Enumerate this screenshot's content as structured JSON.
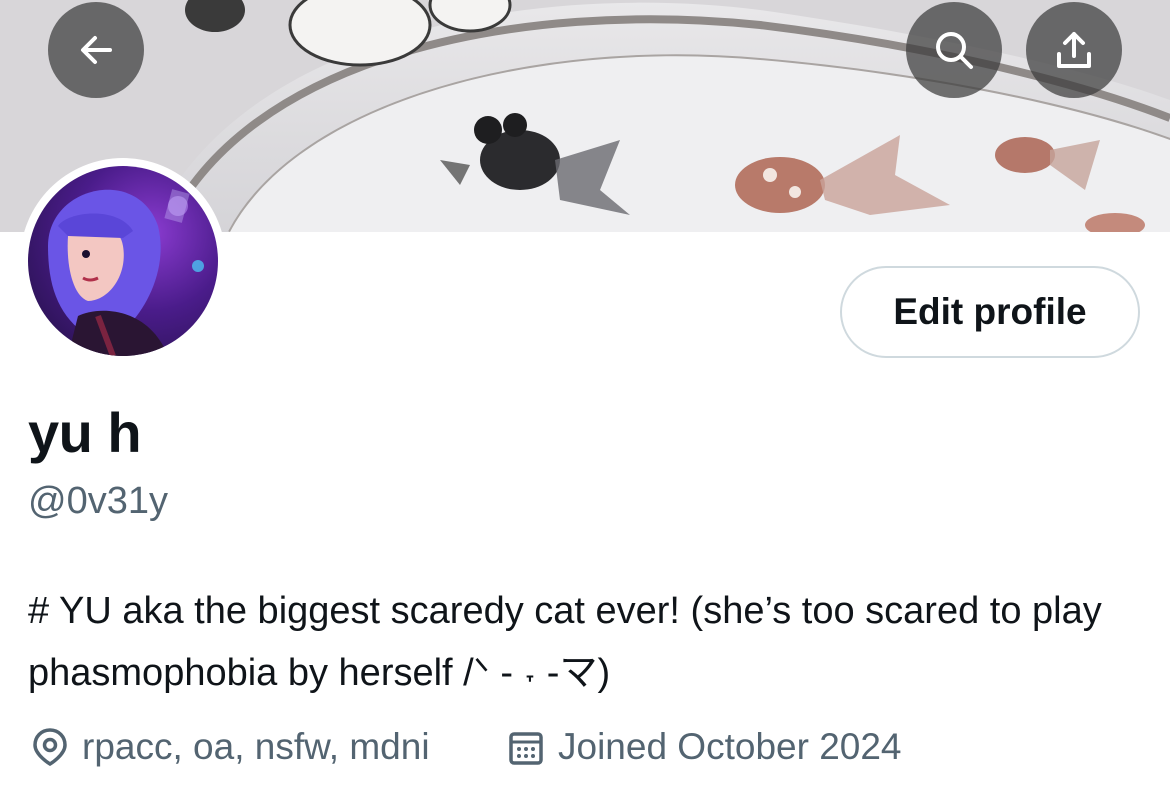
{
  "header": {
    "back_icon": "arrow-left-icon",
    "search_icon": "search-icon",
    "share_icon": "share-icon",
    "overlay_color": "#3c3c3c"
  },
  "profile": {
    "edit_label": "Edit profile",
    "display_name": "yu h",
    "handle": "@0v31y",
    "bio": "# YU aka the biggest scaredy cat ever! (she’s too scared to play phasmophobia by herself /ᐠ - ˕ -マ)",
    "location": "rpacc, oa, nsfw, mdni",
    "location_icon": "location-pin-icon",
    "joined": "Joined October 2024",
    "joined_icon": "calendar-icon"
  },
  "colors": {
    "text_primary": "#0f1419",
    "text_secondary": "#536471",
    "button_border": "#cfd9de",
    "avatar_accent": "#8a3bd0"
  }
}
